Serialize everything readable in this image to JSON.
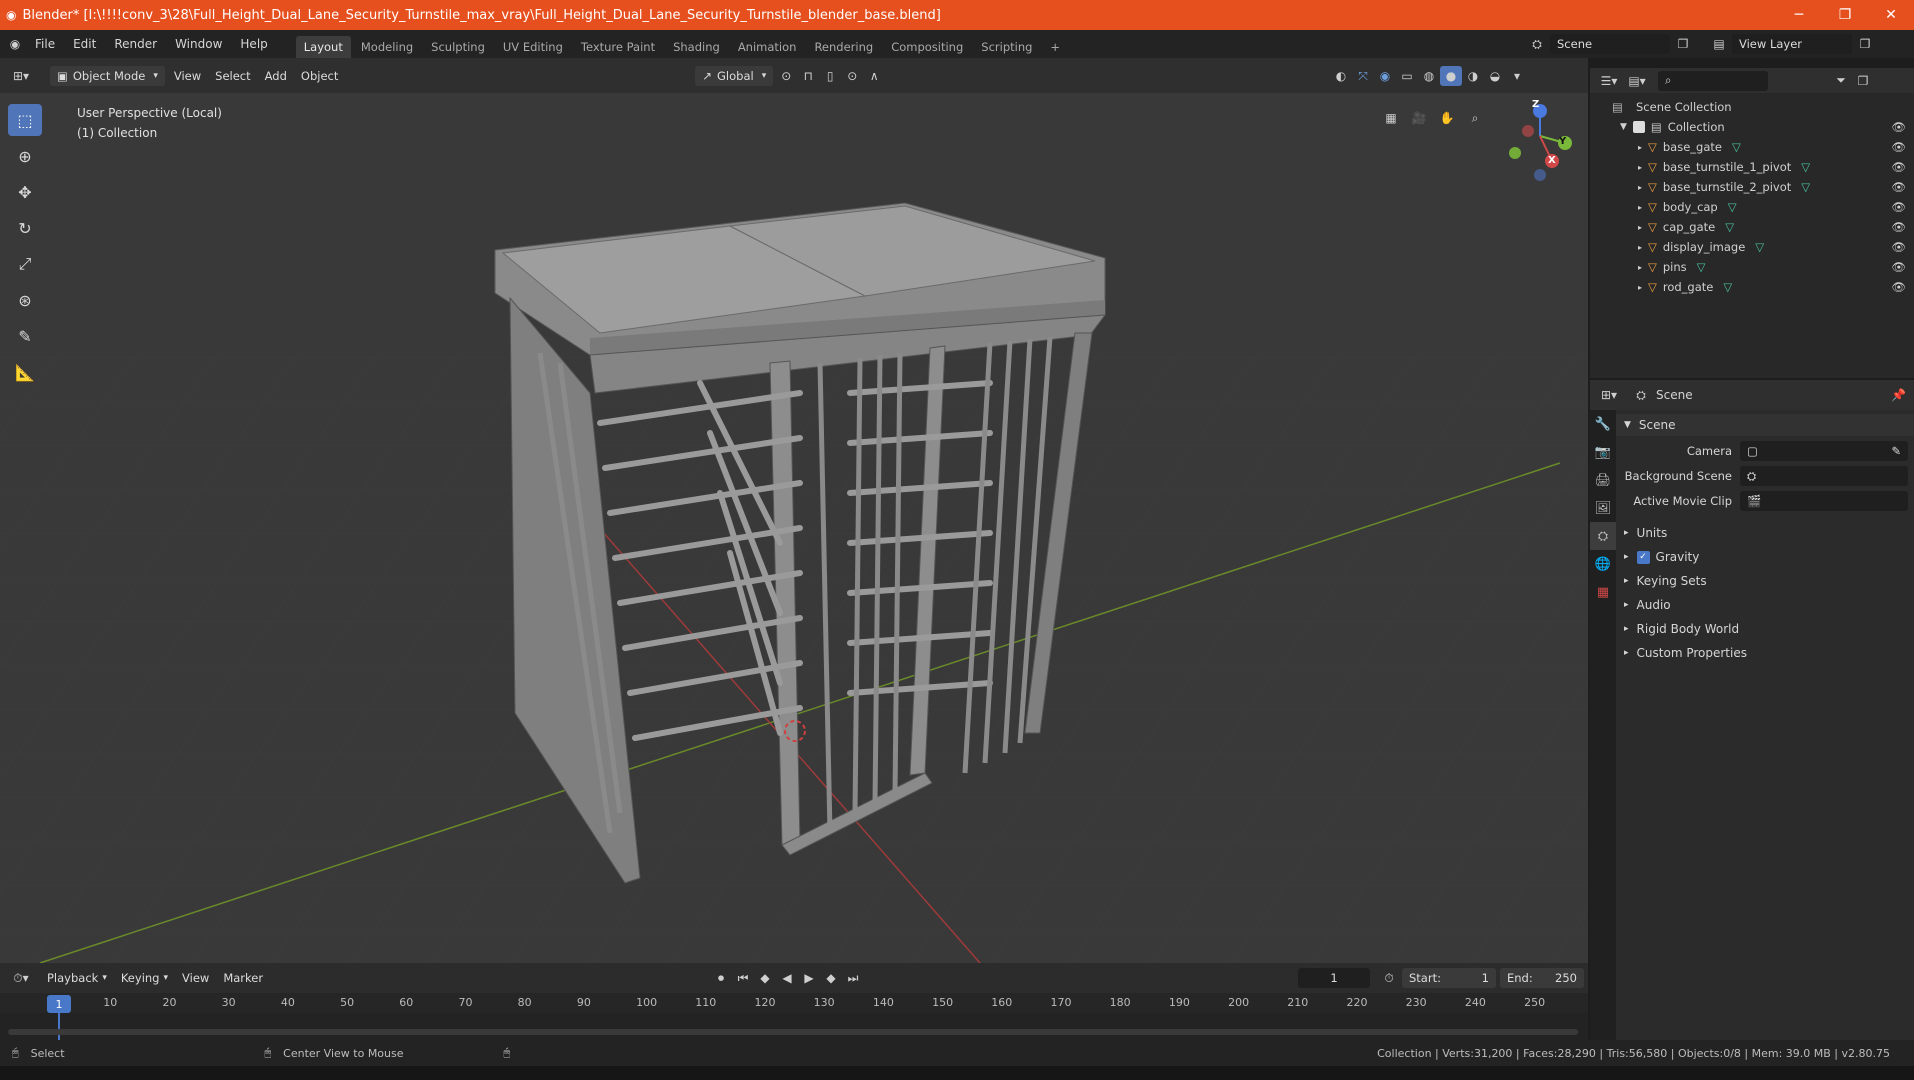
{
  "window": {
    "title": "Blender* [I:\\!!!!conv_3\\28\\Full_Height_Dual_Lane_Security_Turnstile_max_vray\\Full_Height_Dual_Lane_Security_Turnstile_blender_base.blend]",
    "minimize": "─",
    "maximize": "❐",
    "close": "✕"
  },
  "menu": {
    "items": [
      "File",
      "Edit",
      "Render",
      "Window",
      "Help"
    ],
    "workspaces": [
      "Layout",
      "Modeling",
      "Sculpting",
      "UV Editing",
      "Texture Paint",
      "Shading",
      "Animation",
      "Rendering",
      "Compositing",
      "Scripting"
    ],
    "add_tab": "+",
    "scene": "Scene",
    "view_layer": "View Layer"
  },
  "viewport_header": {
    "mode": "Object Mode",
    "view": "View",
    "select": "Select",
    "add": "Add",
    "object": "Object",
    "transform": "Global"
  },
  "viewport": {
    "perspective": "User Perspective (Local)",
    "collection": "(1) Collection",
    "gizmo": {
      "z": "Z",
      "y": "Y",
      "x": "X"
    }
  },
  "outliner": {
    "root": "Scene Collection",
    "collection": "Collection",
    "items": [
      "base_gate",
      "base_turnstile_1_pivot",
      "base_turnstile_2_pivot",
      "body_cap",
      "cap_gate",
      "display_image",
      "pins",
      "rod_gate"
    ]
  },
  "properties": {
    "header": "Scene",
    "section": "Scene",
    "fields": [
      {
        "label": "Camera"
      },
      {
        "label": "Background Scene"
      },
      {
        "label": "Active Movie Clip"
      }
    ],
    "subsections": [
      "Units",
      "Gravity",
      "Keying Sets",
      "Audio",
      "Rigid Body World",
      "Custom Properties"
    ]
  },
  "timeline": {
    "menus": [
      "Playback",
      "Keying",
      "View",
      "Marker"
    ],
    "current_frame": "1",
    "start_label": "Start:",
    "start": "1",
    "end_label": "End:",
    "end": "250",
    "ticks": [
      "10",
      "20",
      "30",
      "40",
      "50",
      "60",
      "70",
      "80",
      "90",
      "100",
      "110",
      "120",
      "130",
      "140",
      "150",
      "160",
      "170",
      "180",
      "190",
      "200",
      "210",
      "220",
      "230",
      "240",
      "250"
    ],
    "playhead": "1"
  },
  "status": {
    "select": "Select",
    "center": "Center View to Mouse",
    "stats": "Collection | Verts:31,200 | Faces:28,290 | Tris:56,580 | Objects:0/8 | Mem: 39.0 MB | v2.80.75"
  }
}
